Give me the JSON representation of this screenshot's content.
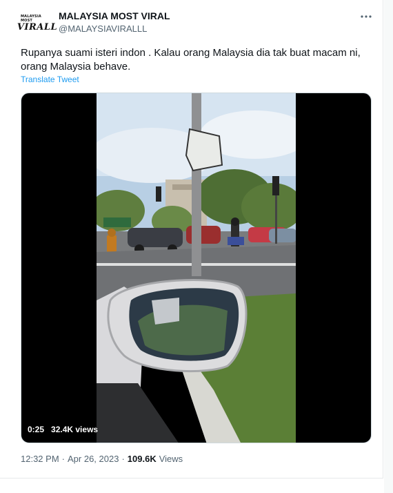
{
  "author": {
    "name": "MALAYSIA MOST VIRAL",
    "handle": "@MALAYSIAVIRALLL",
    "avatar_small": "MALAYSIA MOST",
    "avatar_big": "VIRALL"
  },
  "tweet": {
    "text": "Rupanya suami isteri indon . Kalau orang Malaysia dia tak buat macam ni, orang Malaysia behave.",
    "translate_label": "Translate Tweet"
  },
  "video": {
    "duration": "0:25",
    "views": "32.4K views"
  },
  "footer": {
    "time": "12:32 PM",
    "separator": "·",
    "date": "Apr 26, 2023",
    "separator2": "·",
    "views_count": "109.6K",
    "views_label": "Views"
  },
  "icons": {
    "more": "more-icon"
  },
  "colors": {
    "link": "#1d9bf0",
    "secondary_text": "#536471",
    "primary_text": "#0f1419"
  }
}
